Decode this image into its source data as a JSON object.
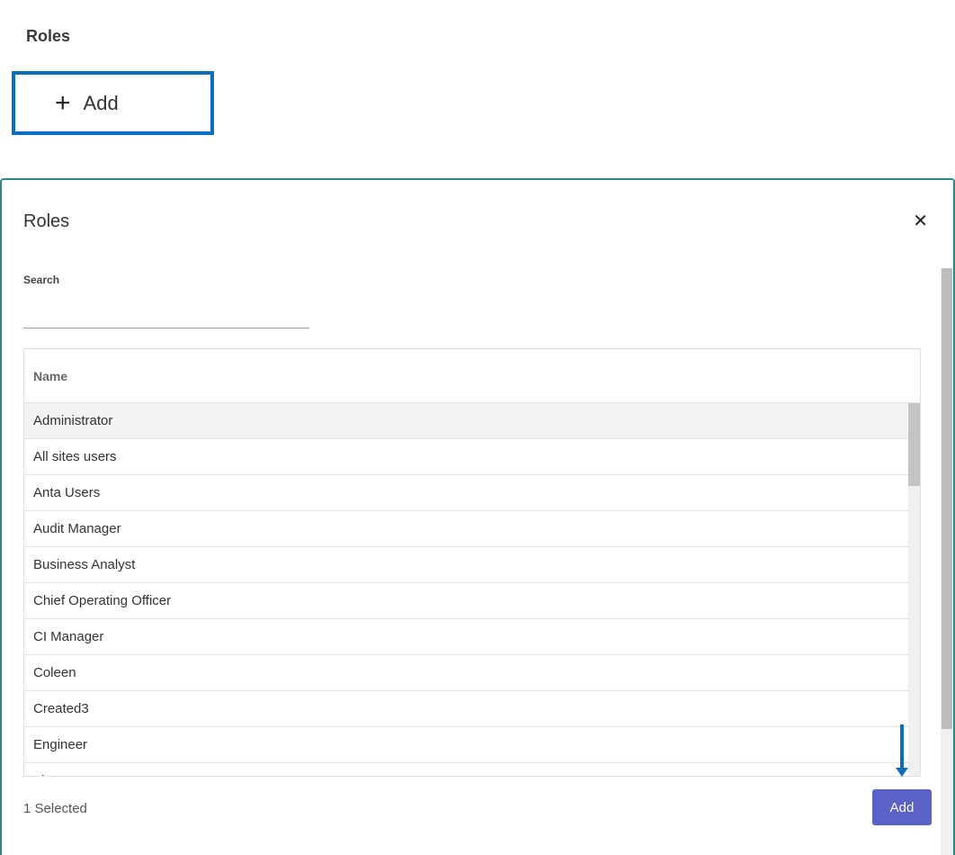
{
  "page": {
    "title": "Roles"
  },
  "trigger": {
    "icon": "plus-icon",
    "label": "Add"
  },
  "dialog": {
    "title": "Roles",
    "close_icon": "close-icon",
    "search": {
      "label": "Search",
      "value": "",
      "placeholder": ""
    },
    "table": {
      "column_header": "Name",
      "rows": [
        {
          "name": "Administrator",
          "selected": true
        },
        {
          "name": "All sites users",
          "selected": false
        },
        {
          "name": "Anta Users",
          "selected": false
        },
        {
          "name": "Audit Manager",
          "selected": false
        },
        {
          "name": "Business Analyst",
          "selected": false
        },
        {
          "name": "Chief Operating Officer",
          "selected": false
        },
        {
          "name": "CI Manager",
          "selected": false
        },
        {
          "name": "Coleen",
          "selected": false
        },
        {
          "name": "Created3",
          "selected": false
        },
        {
          "name": "Engineer",
          "selected": false
        },
        {
          "name": "Finance Manager",
          "selected": false
        }
      ]
    },
    "footer": {
      "selected_count": "1 Selected",
      "add_label": "Add"
    }
  },
  "colors": {
    "accent_border": "#0a6ebd",
    "dialog_border": "#2b8a88",
    "primary_button": "#5a62c7",
    "arrow": "#0a6ebd"
  }
}
